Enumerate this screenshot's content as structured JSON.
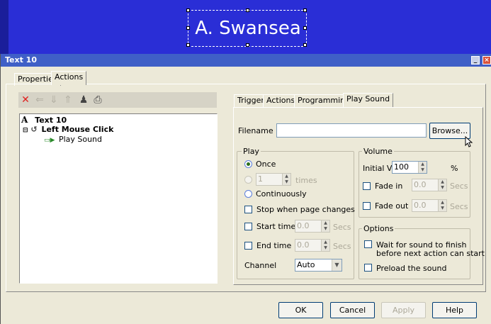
{
  "canvas": {
    "text_object_label": "A. Swansea"
  },
  "window": {
    "title": "Text 10",
    "minimize_icon": "minimize-icon",
    "close_icon": "close-icon"
  },
  "outer_tabs": [
    {
      "label": "Properties",
      "active": false
    },
    {
      "label": "Actions",
      "active": true
    }
  ],
  "toolbar": {
    "icons": [
      "delete-icon",
      "move-left-icon",
      "move-down-icon",
      "move-up-icon",
      "person-icon",
      "print-icon"
    ]
  },
  "tree": {
    "root": {
      "label": "Text 10",
      "icon": "text-A-icon"
    },
    "trigger": {
      "label": "Left Mouse Click",
      "icon": "mouse-click-icon"
    },
    "action": {
      "label": "Play Sound",
      "icon": "play-sound-icon"
    }
  },
  "inner_tabs": [
    {
      "label": "Triggers",
      "active": false
    },
    {
      "label": "Actions",
      "active": false
    },
    {
      "label": "Programming",
      "active": false
    },
    {
      "label": "Play Sound",
      "active": true
    }
  ],
  "play_sound": {
    "filename_label": "Filename",
    "filename_value": "",
    "browse_label": "Browse...",
    "play": {
      "title": "Play",
      "once_label": "Once",
      "times_value": "1",
      "times_label": "times",
      "continuously_label": "Continuously",
      "stop_label": "Stop when page changes",
      "start_time_label": "Start time",
      "start_time_value": "0.0",
      "end_time_label": "End time",
      "end_time_value": "0.0",
      "secs_label": "Secs",
      "channel_label": "Channel",
      "channel_value": "Auto"
    },
    "volume": {
      "title": "Volume",
      "initial_label": "Initial Volume",
      "initial_value": "100",
      "percent_label": "%",
      "fade_in_label": "Fade in",
      "fade_in_value": "0.0",
      "fade_out_label": "Fade out",
      "fade_out_value": "0.0",
      "secs_label": "Secs"
    },
    "options": {
      "title": "Options",
      "wait_line1": "Wait for sound to finish",
      "wait_line2": "before next action can start",
      "preload_label": "Preload the sound"
    }
  },
  "footer": {
    "ok": "OK",
    "cancel": "Cancel",
    "apply": "Apply",
    "help": "Help"
  },
  "colors": {
    "canvas_bg": "#2a2ed6",
    "titlebar": "#3f5fc7",
    "dialog_bg": "#ece9d8",
    "delete_red": "#e0201e"
  }
}
